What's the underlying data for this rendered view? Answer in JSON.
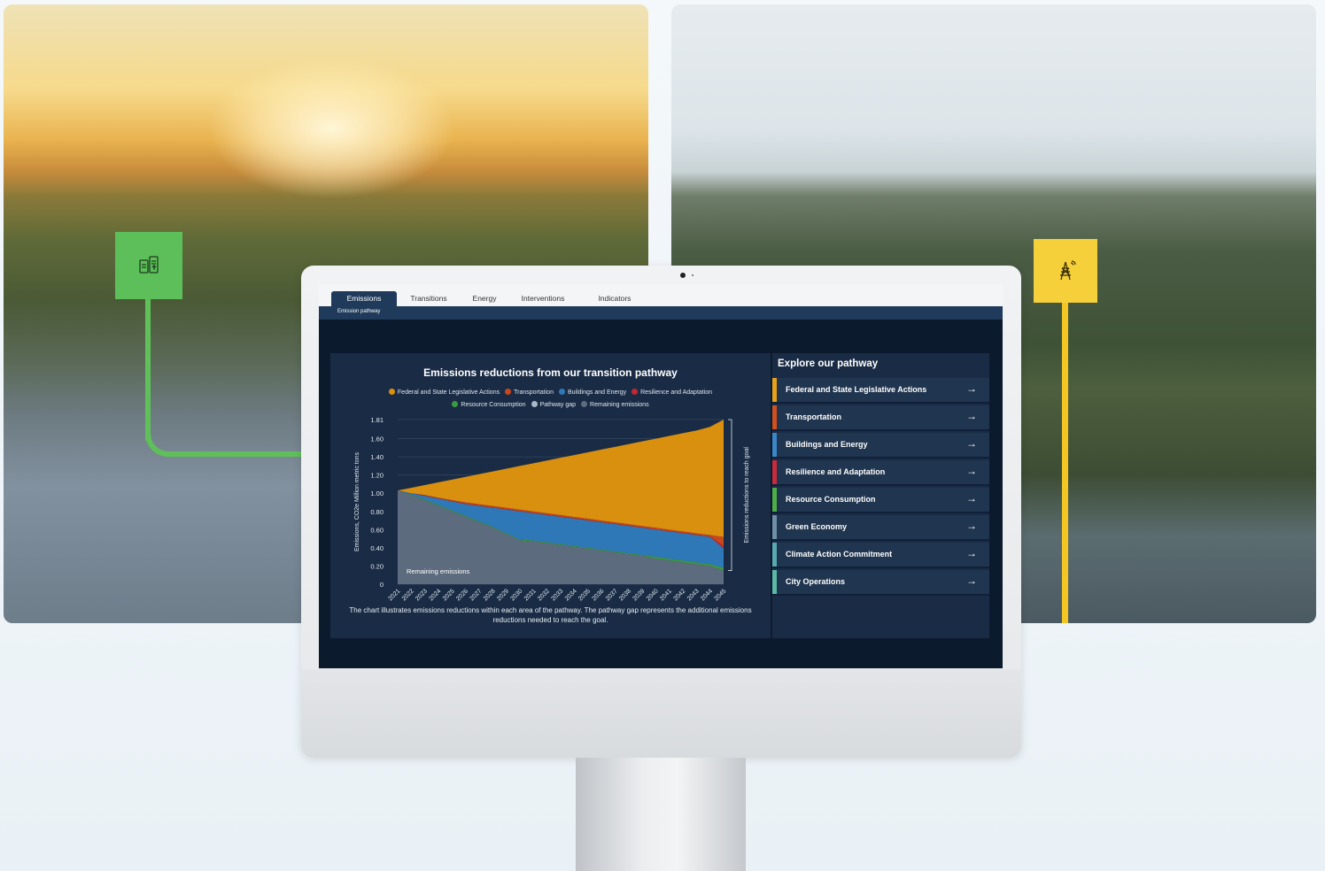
{
  "colors": {
    "green_accent": "#5cbf5a",
    "yellow_accent": "#f6d03a",
    "screen_bg": "#0c1a2e",
    "panel_bg": "#1a2c45"
  },
  "badges": {
    "left_icon": "document-recycle-icon",
    "right_icon": "power-tower-icon"
  },
  "dashboard": {
    "tabs": [
      "Emissions",
      "Transitions",
      "Energy",
      "Interventions",
      "Indicators"
    ],
    "active_tab": "Emissions",
    "subtab": "Emission pathway"
  },
  "chart": {
    "title": "Emissions reductions from our transition pathway",
    "caption": "The chart illustrates emissions reductions within each area of the pathway. The pathway gap represents the additional emissions reductions needed to reach the goal.",
    "legend_row1": [
      {
        "name": "Federal and State Legislative Actions",
        "color": "#d9900f"
      },
      {
        "name": "Transportation",
        "color": "#c9471c"
      },
      {
        "name": "Buildings and Energy",
        "color": "#2f78b8"
      },
      {
        "name": "Resilience and Adaptation",
        "color": "#c2282e"
      }
    ],
    "legend_row2": [
      {
        "name": "Resource Consumption",
        "color": "#3b9a3e"
      },
      {
        "name": "Pathway gap",
        "color": "#a9b9c9"
      },
      {
        "name": "Remaining emissions",
        "color": "#5d6b7e"
      }
    ],
    "area_label": "Remaining emissions",
    "bracket_label": "Emissions reductions to reach goal"
  },
  "chart_data": {
    "type": "area",
    "title": "Emissions reductions from our transition pathway",
    "xlabel": "",
    "ylabel": "Emissions, CO2e Million metric tons",
    "y_ticks": [
      "0",
      "0.20",
      "0.40",
      "0.60",
      "0.80",
      "1.00",
      "1.20",
      "1.40",
      "1.60",
      "1.81"
    ],
    "ylim": [
      0,
      1.81
    ],
    "x": [
      "2021",
      "2022",
      "2023",
      "2024",
      "2025",
      "2026",
      "2027",
      "2028",
      "2029",
      "2030",
      "2031",
      "2032",
      "2033",
      "2034",
      "2035",
      "2036",
      "2037",
      "2038",
      "2039",
      "2040",
      "2041",
      "2042",
      "2043",
      "2044",
      "2045"
    ],
    "stack_boundaries": {
      "remaining_emissions_top": [
        1.03,
        0.98,
        0.92,
        0.86,
        0.8,
        0.74,
        0.68,
        0.62,
        0.55,
        0.48,
        0.47,
        0.45,
        0.43,
        0.41,
        0.39,
        0.37,
        0.35,
        0.33,
        0.31,
        0.28,
        0.26,
        0.24,
        0.22,
        0.2,
        0.15
      ],
      "resource_consumption_top": [
        1.03,
        0.985,
        0.93,
        0.87,
        0.81,
        0.75,
        0.69,
        0.63,
        0.56,
        0.49,
        0.48,
        0.46,
        0.44,
        0.42,
        0.4,
        0.38,
        0.36,
        0.34,
        0.32,
        0.3,
        0.28,
        0.26,
        0.24,
        0.22,
        0.18
      ],
      "buildings_and_energy_top": [
        1.03,
        1.0,
        0.97,
        0.94,
        0.91,
        0.88,
        0.86,
        0.84,
        0.82,
        0.8,
        0.78,
        0.76,
        0.74,
        0.72,
        0.7,
        0.68,
        0.66,
        0.64,
        0.62,
        0.6,
        0.58,
        0.56,
        0.54,
        0.52,
        0.39
      ],
      "resilience_and_adaptation_top": [
        1.03,
        1.0,
        0.975,
        0.945,
        0.915,
        0.885,
        0.865,
        0.845,
        0.825,
        0.805,
        0.785,
        0.765,
        0.745,
        0.725,
        0.705,
        0.685,
        0.665,
        0.645,
        0.625,
        0.605,
        0.585,
        0.565,
        0.545,
        0.525,
        0.42
      ],
      "transportation_top": [
        1.03,
        1.0,
        0.98,
        0.95,
        0.925,
        0.9,
        0.88,
        0.86,
        0.84,
        0.82,
        0.8,
        0.78,
        0.76,
        0.74,
        0.72,
        0.7,
        0.68,
        0.66,
        0.64,
        0.62,
        0.6,
        0.58,
        0.56,
        0.54,
        0.52
      ],
      "federal_and_state_legislative_actions_top": [
        1.03,
        1.06,
        1.09,
        1.12,
        1.15,
        1.18,
        1.21,
        1.24,
        1.27,
        1.3,
        1.33,
        1.36,
        1.39,
        1.42,
        1.45,
        1.48,
        1.51,
        1.54,
        1.57,
        1.6,
        1.63,
        1.66,
        1.69,
        1.73,
        1.81
      ]
    },
    "series": [
      {
        "name": "Federal and State Legislative Actions",
        "color": "#d9900f"
      },
      {
        "name": "Transportation",
        "color": "#c9471c"
      },
      {
        "name": "Buildings and Energy",
        "color": "#2f78b8"
      },
      {
        "name": "Resilience and Adaptation",
        "color": "#c2282e"
      },
      {
        "name": "Resource Consumption",
        "color": "#3b9a3e"
      },
      {
        "name": "Pathway gap",
        "color": "#a9b9c9"
      },
      {
        "name": "Remaining emissions",
        "color": "#5d6b7e"
      }
    ],
    "grid": true,
    "legend_placement": "top"
  },
  "explore": {
    "title": "Explore our pathway",
    "items": [
      {
        "label": "Federal and State Legislative Actions",
        "color": "#e8a21a"
      },
      {
        "label": "Transportation",
        "color": "#d0501f"
      },
      {
        "label": "Buildings and Energy",
        "color": "#3b86c6"
      },
      {
        "label": "Resilience and Adaptation",
        "color": "#c92b3a"
      },
      {
        "label": "Resource Consumption",
        "color": "#4fae46"
      },
      {
        "label": "Green Economy",
        "color": "#6f8fa8"
      },
      {
        "label": "Climate Action Commitment",
        "color": "#5aa9b0"
      },
      {
        "label": "City Operations",
        "color": "#5db7a6"
      }
    ],
    "arrow": "→"
  }
}
